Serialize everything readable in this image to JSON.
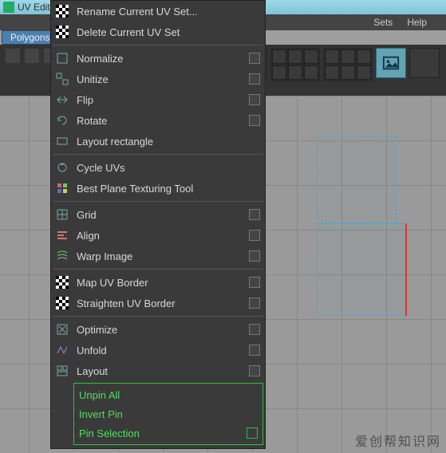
{
  "window": {
    "title": "UV Editor"
  },
  "menubar": {
    "sets": "Sets",
    "help": "Help"
  },
  "mode_tab": "Polygons",
  "menu": {
    "rename": "Rename Current UV Set...",
    "delete": "Delete Current UV Set",
    "normalize": "Normalize",
    "unitize": "Unitize",
    "flip": "Flip",
    "rotate": "Rotate",
    "layout_rect": "Layout rectangle",
    "cycle": "Cycle UVs",
    "best_plane": "Best Plane Texturing Tool",
    "grid": "Grid",
    "align": "Align",
    "warp": "Warp Image",
    "map_border": "Map UV Border",
    "straighten": "Straighten UV Border",
    "optimize": "Optimize",
    "unfold": "Unfold",
    "layout": "Layout",
    "unpin_all": "Unpin All",
    "invert_pin": "Invert Pin",
    "pin_selection": "Pin Selection"
  },
  "watermark": "爱创帮知识网"
}
